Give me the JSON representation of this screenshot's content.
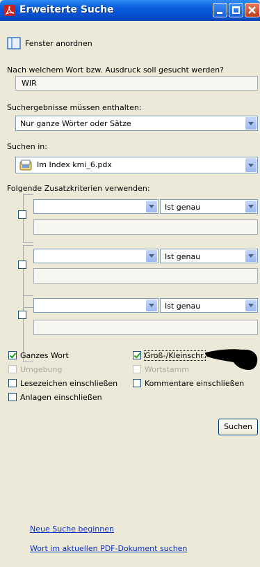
{
  "window": {
    "title": "Erweiterte Suche",
    "buttons": [
      "minimize",
      "maximize",
      "close"
    ]
  },
  "arrange": {
    "label": "Fenster anordnen",
    "icon": "window-arrange-icon"
  },
  "query": {
    "label": "Nach welchem Wort bzw. Ausdruck soll gesucht werden?",
    "value": "WIR"
  },
  "match": {
    "label": "Suchergebnisse müssen enthalten:",
    "selected": "Nur ganze Wörter oder Sätze"
  },
  "scope": {
    "label": "Suchen in:",
    "selected": "Im Index kmi_6.pdx",
    "icon": "index-file-icon"
  },
  "criteria": {
    "label": "Folgende Zusatzkriterien verwenden:",
    "rows": [
      {
        "field": "",
        "operator": "Ist genau",
        "value": ""
      },
      {
        "field": "",
        "operator": "Ist genau",
        "value": ""
      },
      {
        "field": "",
        "operator": "Ist genau",
        "value": ""
      }
    ]
  },
  "options": {
    "whole_word": {
      "label": "Ganzes Wort",
      "checked": true
    },
    "case_sensitive": {
      "label": "Groß-/Kleinschr.",
      "checked": true
    },
    "proximity": {
      "label": "Umgebung",
      "enabled": false
    },
    "stemming": {
      "label": "Wortstamm",
      "enabled": false
    },
    "bookmarks": {
      "label": "Lesezeichen einschließen",
      "checked": false
    },
    "comments": {
      "label": "Kommentare einschließen",
      "checked": false
    },
    "attachments": {
      "label": "Anlagen einschließen",
      "checked": false
    }
  },
  "search_button": "Suchen",
  "links": {
    "new_search": "Neue Suche beginnen",
    "search_in_document": "Wort im aktuellen PDF-Dokument suchen"
  },
  "colors": {
    "titlebar": "#0550d2",
    "window_bg": "#ece9d8",
    "link": "#0c30c0",
    "check": "#21a121"
  }
}
